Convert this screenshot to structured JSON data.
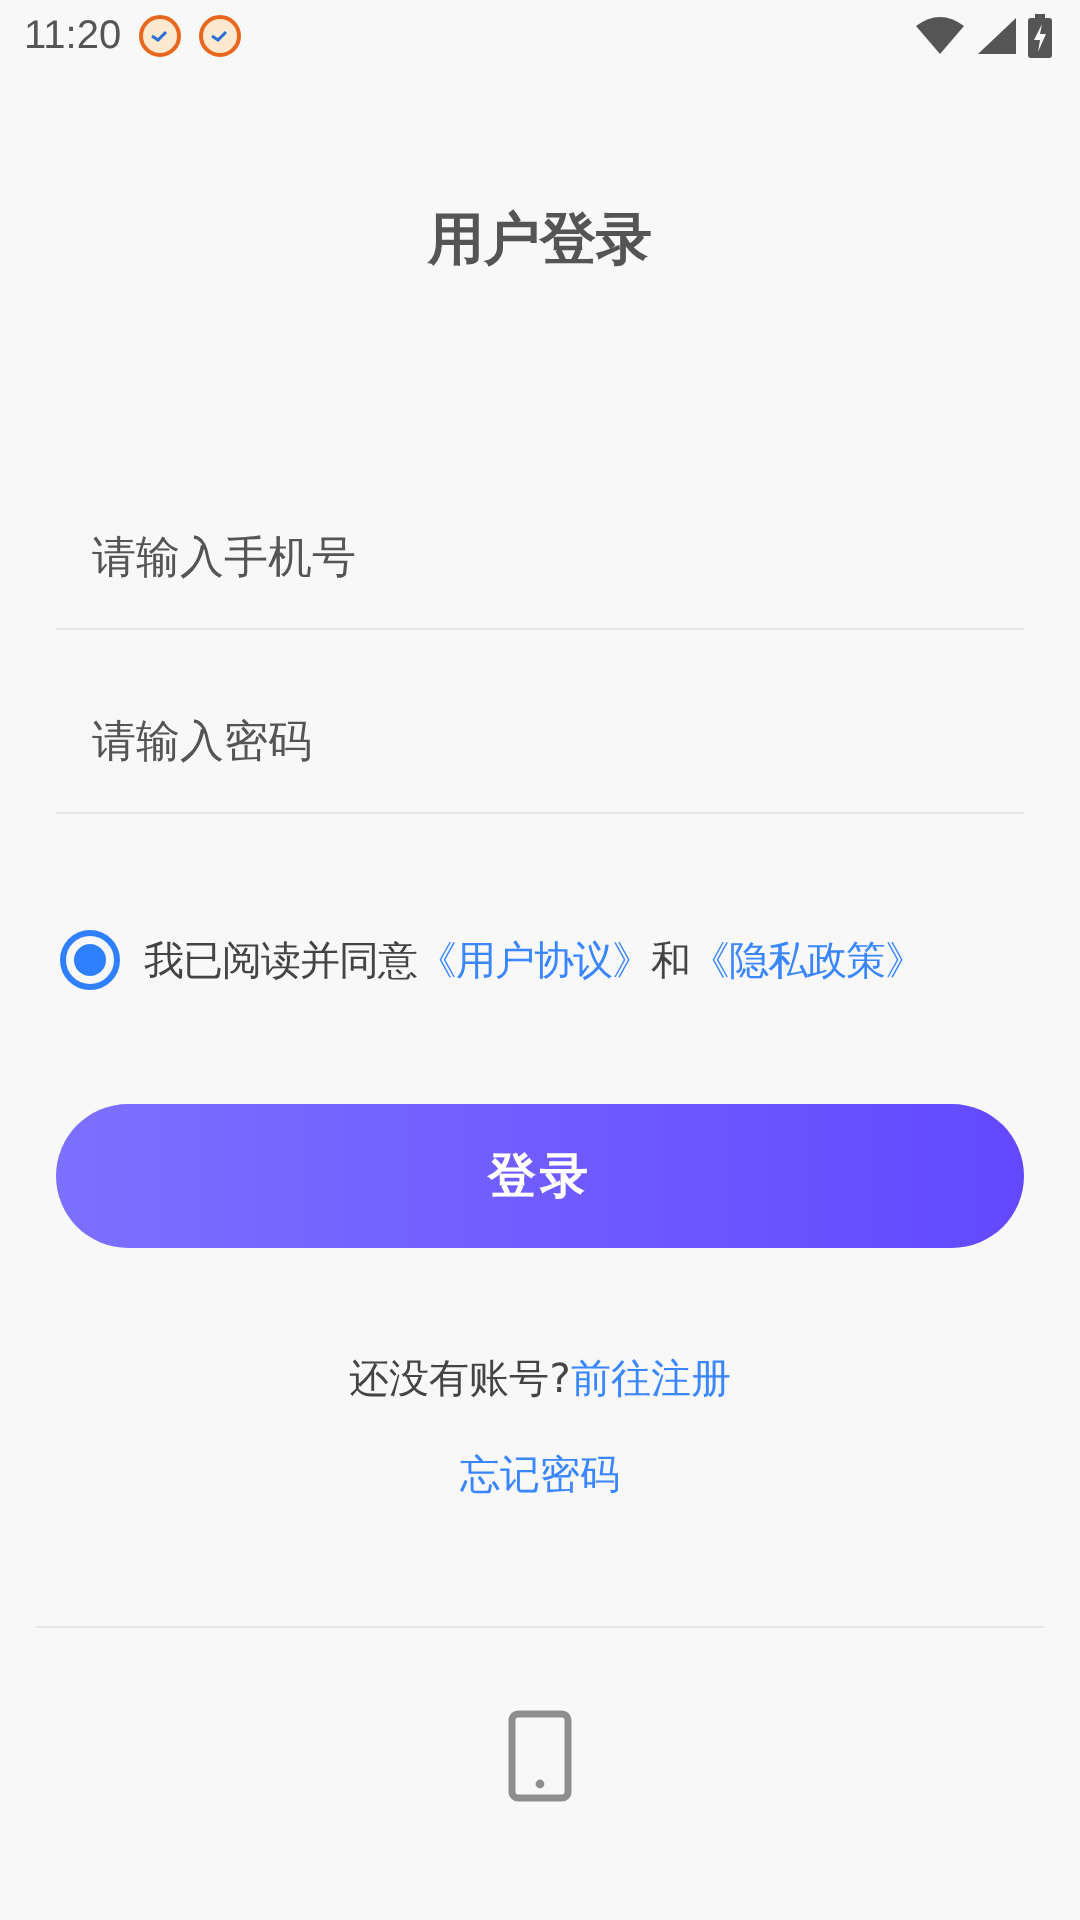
{
  "status_bar": {
    "time": "11:20"
  },
  "title": "用户登录",
  "fields": [
    {
      "placeholder": "请输入手机号"
    },
    {
      "placeholder": "请输入密码"
    }
  ],
  "agreement": {
    "checked": true,
    "parts": [
      {
        "kind": "text",
        "text": "我已阅读并同意"
      },
      {
        "kind": "link",
        "text": "《用户协议》"
      },
      {
        "kind": "text",
        "text": "和"
      },
      {
        "kind": "link",
        "text": "《隐私政策》"
      }
    ]
  },
  "login_button": "登录",
  "register": {
    "prompt": "还没有账号?",
    "link": "前往注册"
  },
  "forgot_link": "忘记密码"
}
